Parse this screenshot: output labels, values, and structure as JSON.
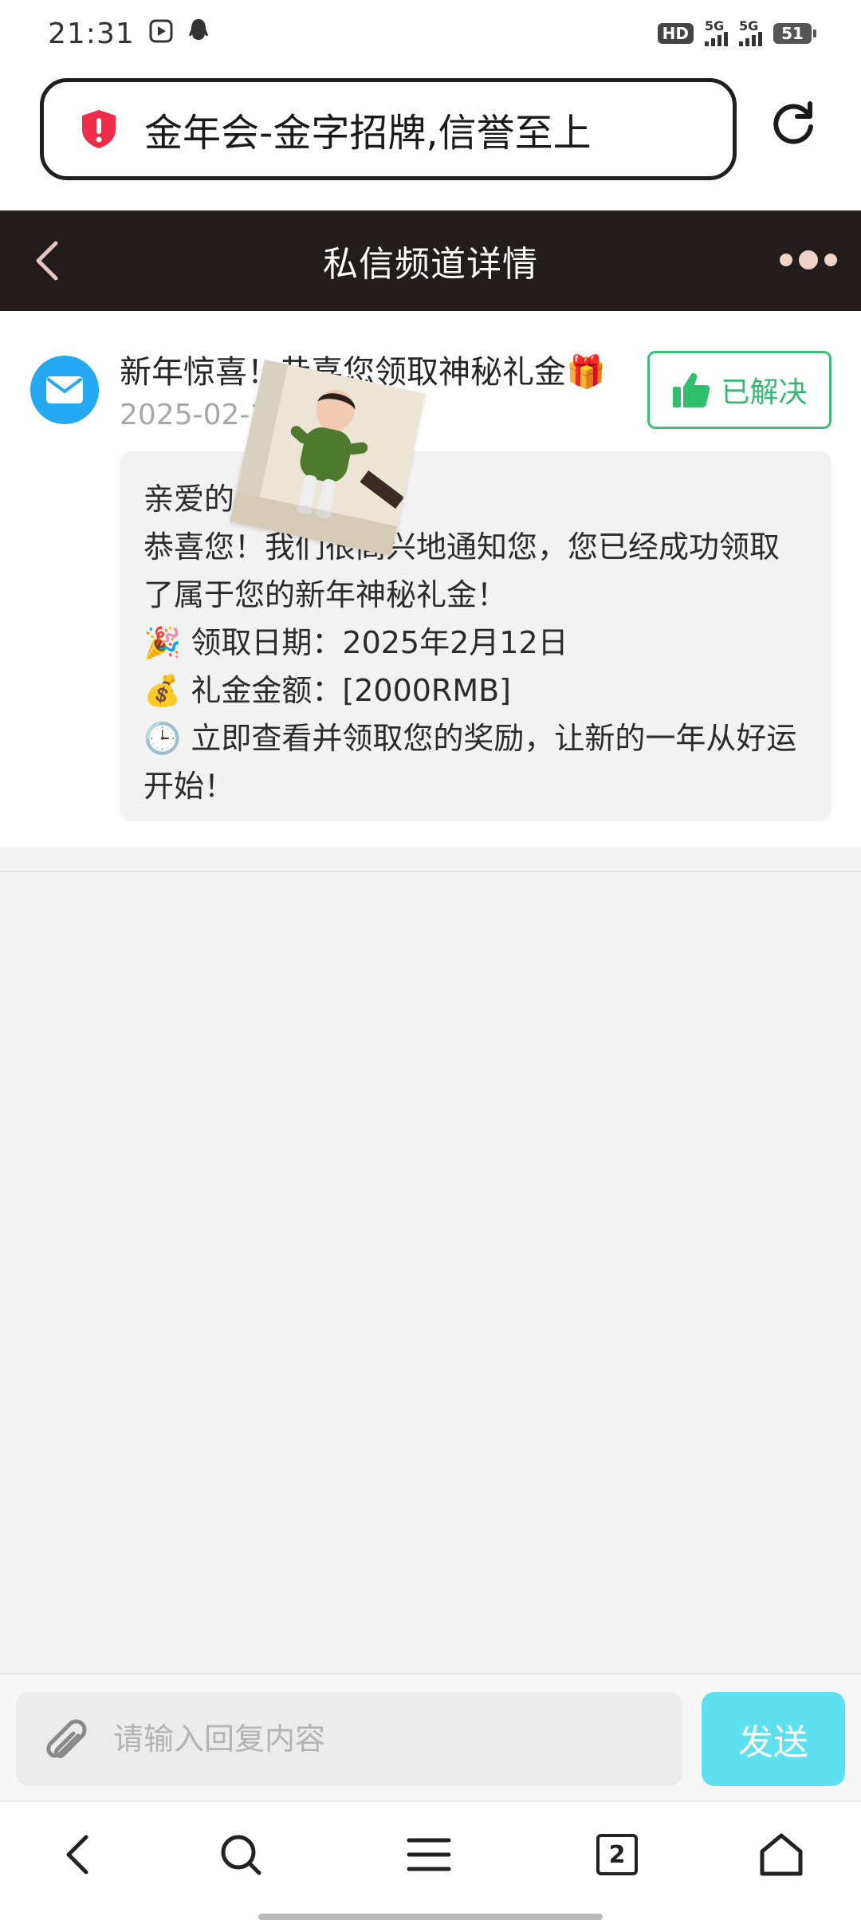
{
  "status_bar": {
    "time": "21:31",
    "hd_label": "HD",
    "network_1": "5G",
    "network_2": "5G",
    "battery": "51"
  },
  "browser": {
    "url_title": "金年会-金字招牌,信誉至上",
    "security_icon": "shield-alert-icon",
    "reload_icon": "reload-icon"
  },
  "header": {
    "title": "私信频道详情",
    "back_icon": "chevron-left-icon",
    "more_icon": "more-dots-icon",
    "accent_color": "#231c1d"
  },
  "message": {
    "title": "新年惊喜！恭喜您领取神秘礼金🎁",
    "date": "2025-02-1",
    "resolved_label": "已解决",
    "body_lines": [
      "亲爱的",
      "恭喜您！我们很高兴地通知您，您已经成功领取了属于您的新年神秘礼金！",
      "🎉 领取日期：2025年2月12日",
      "💰 礼金金额：[2000RMB]",
      "🕒 立即查看并领取您的奖励，让新的一年从好运开始！"
    ]
  },
  "reply": {
    "placeholder": "请输入回复内容",
    "send_label": "发送"
  },
  "nav": {
    "tab_count": "2"
  }
}
